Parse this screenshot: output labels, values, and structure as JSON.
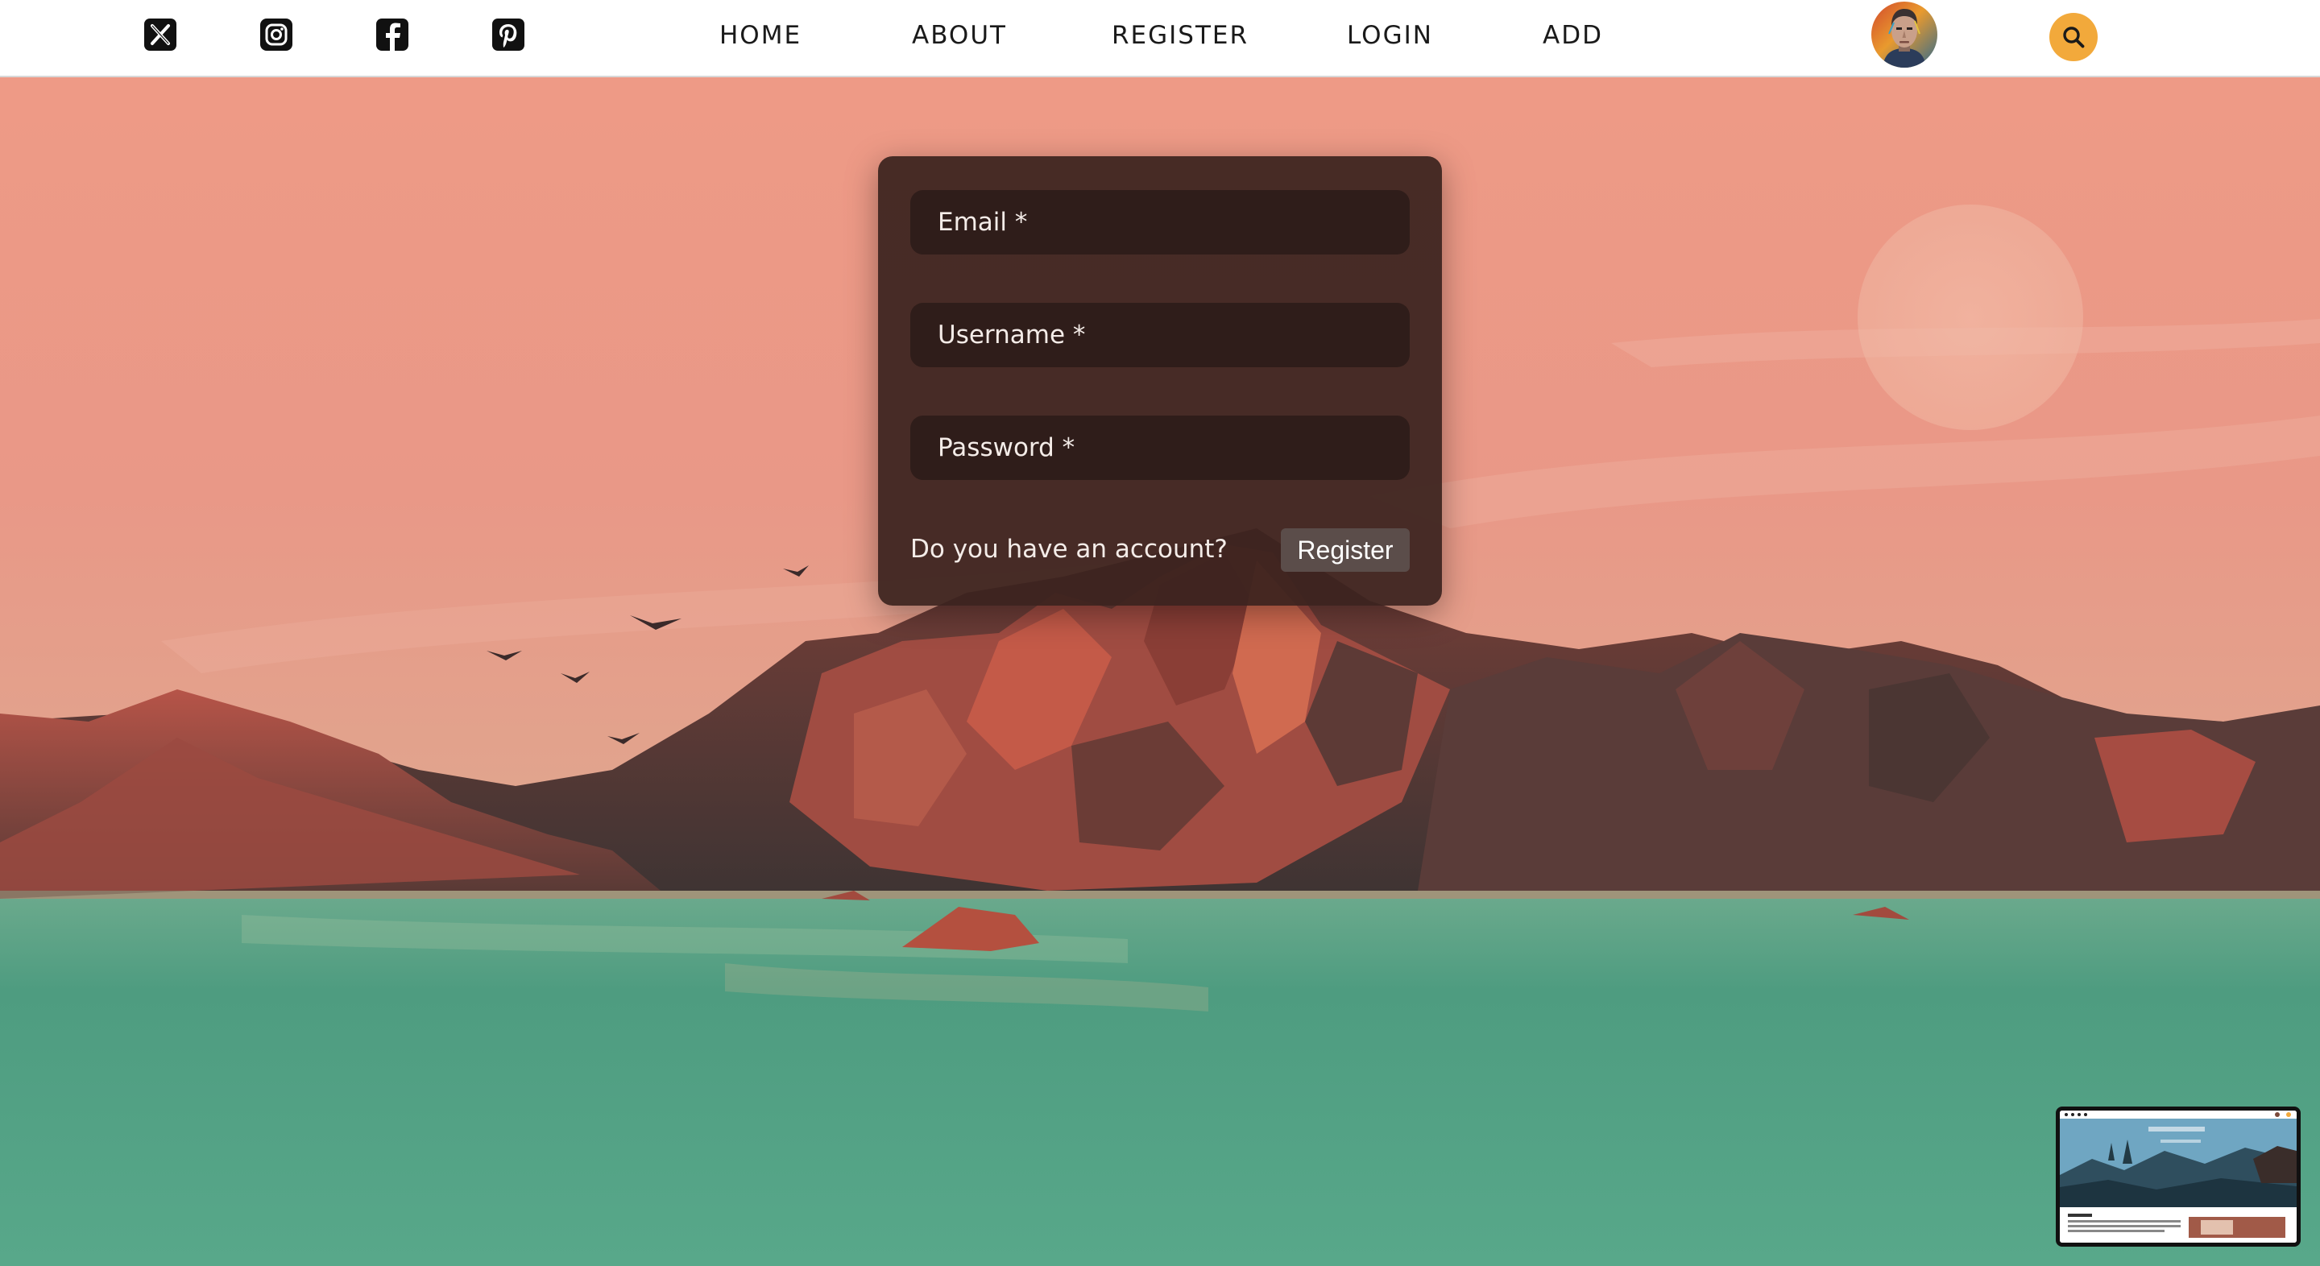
{
  "nav": {
    "social_icons": [
      "x-icon",
      "instagram-icon",
      "facebook-icon",
      "pinterest-icon"
    ],
    "links": [
      "HOME",
      "ABOUT",
      "REGISTER",
      "LOGIN",
      "ADD"
    ],
    "search_icon": "search-icon",
    "accent_color": "#f2a93b"
  },
  "form": {
    "email_placeholder": "Email *",
    "username_placeholder": "Username *",
    "password_placeholder": "Password *",
    "question": "Do you have an account?",
    "register_label": "Register"
  }
}
